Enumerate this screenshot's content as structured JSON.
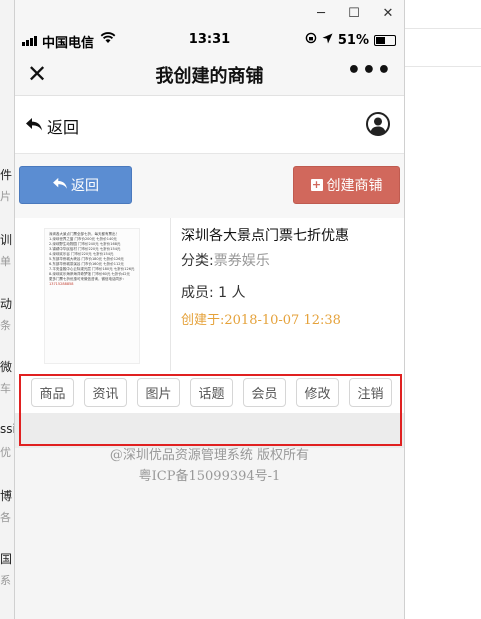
{
  "window": {
    "minimize": "─",
    "maximize": "☐",
    "close": "✕"
  },
  "status_bar": {
    "carrier": "中国电信",
    "time": "13:31",
    "battery_pct": "51%",
    "battery_level": 0.51
  },
  "nav": {
    "title": "我创建的商铺",
    "close": "✕",
    "more": "•••"
  },
  "sub_header": {
    "back_label": "返回"
  },
  "actions": {
    "back_label": "返回",
    "create_label": "创建商铺"
  },
  "shop": {
    "title": "深圳各大景点门票七折优惠",
    "category_label": "分类:",
    "category_value": "票券娱乐",
    "members": "成员: 1 人",
    "created": "创建于:2018-10-07 12:38",
    "poster_lines": [
      "深圳各大景点门票全部七折，每天都有票出！",
      "1.深圳世界之窗 门市价200元 七折价140元",
      "2.深圳野生动物园 门市价240元 七折价168元",
      "3.锦绣中华民俗村 门市价220元 七折价154元",
      "4.深圳欢乐谷 门市价220元 七折价154元",
      "5.东部华侨城大峡谷 门市价180元 七折价126元",
      "6.东部华侨城茶溪谷 门市价160元 七折价112元",
      "7.平安金融中心云际观光层 门市价180元 七折价126元",
      "8.深圳欢乐海岸海洋奇梦馆 门市价60元 七折价42元",
      "更多门票七折优惠可来微信咨询，微信电话同步：",
      "13715288858"
    ]
  },
  "menu": [
    "商品",
    "资讯",
    "图片",
    "话题",
    "会员",
    "修改",
    "注销"
  ],
  "footer": {
    "line1": "@深圳优品资源管理系统 版权所有",
    "line2": "粤ICP备15099394号-1"
  },
  "colors": {
    "blue_button": "#5b8dd2",
    "red_button": "#d1685c",
    "created_text": "#e5a23b",
    "highlight": "#e02020"
  },
  "background_snippets": [
    "件",
    "片",
    "训",
    "单",
    "动",
    "条",
    "微",
    "车",
    "ssi",
    "优",
    "博",
    "各",
    "国",
    "系"
  ]
}
